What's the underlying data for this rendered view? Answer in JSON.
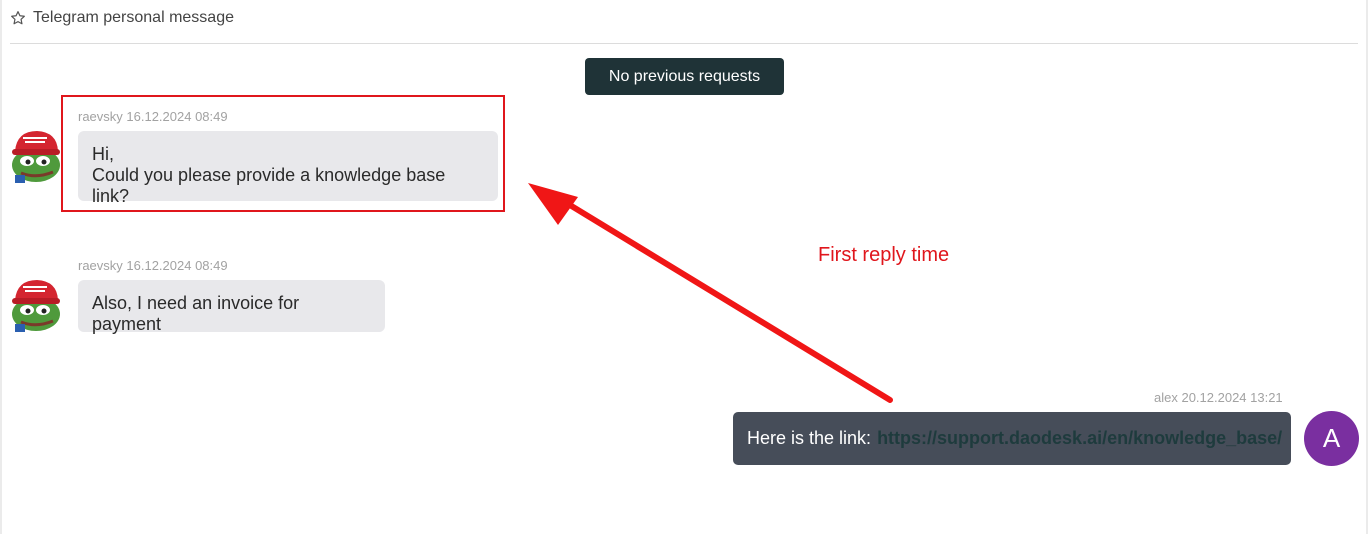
{
  "header": {
    "title": "Telegram personal message",
    "icon": "star-outline-icon"
  },
  "no_previous_button": "No previous requests",
  "messages": [
    {
      "author": "raevsky",
      "datetime": "16.12.2024 08:49",
      "meta": "raevsky 16.12.2024 08:49",
      "lines": [
        "Hi,",
        "Could you please provide a knowledge base link?"
      ]
    },
    {
      "author": "raevsky",
      "datetime": "16.12.2024 08:49",
      "meta": "raevsky 16.12.2024 08:49",
      "lines": [
        "Also, I need an invoice for payment"
      ]
    }
  ],
  "reply": {
    "author": "alex",
    "datetime": "20.12.2024 13:21",
    "meta": "alex 20.12.2024 13:21",
    "text": "Here is the link:",
    "link": "https://support.daodesk.ai/en/knowledge_base/",
    "avatar_letter": "A"
  },
  "annotation": {
    "label": "First reply time",
    "color": "#e0161c"
  },
  "colors": {
    "accent_button": "#1f3337",
    "outgoing_bubble": "#464d59",
    "avatar_purple": "#7a2fa0"
  }
}
